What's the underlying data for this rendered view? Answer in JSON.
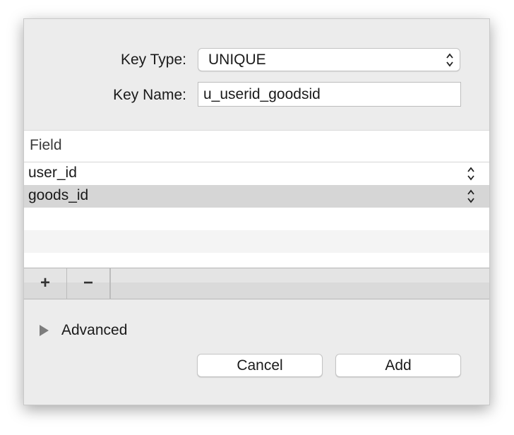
{
  "form": {
    "key_type_label": "Key Type:",
    "key_type_value": "UNIQUE",
    "key_name_label": "Key Name:",
    "key_name_value": "u_userid_goodsid"
  },
  "table": {
    "header": "Field",
    "rows": [
      {
        "field": "user_id",
        "selected": false
      },
      {
        "field": "goods_id",
        "selected": true
      }
    ]
  },
  "toolbar": {
    "add_label": "+",
    "remove_label": "−"
  },
  "advanced": {
    "label": "Advanced",
    "expanded": false
  },
  "buttons": {
    "cancel_label": "Cancel",
    "add_label": "Add"
  },
  "icons": {
    "disclosure": "disclosure-triangle-icon",
    "updown": "up-down-chevron-icon"
  },
  "colors": {
    "selected_row": "#d6d6d6",
    "sheet_background": "#ececec"
  }
}
